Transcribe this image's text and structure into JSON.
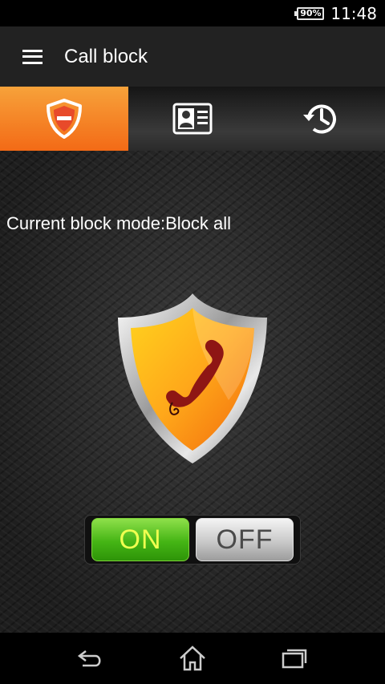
{
  "status_bar": {
    "battery": "90%",
    "time": "11:48"
  },
  "app_bar": {
    "title": "Call block",
    "menu_icon": "hamburger-menu-icon"
  },
  "tabs": [
    {
      "name": "block-shield",
      "icon": "shield-minus-icon",
      "active": true
    },
    {
      "name": "contacts",
      "icon": "contact-card-icon",
      "active": false
    },
    {
      "name": "history",
      "icon": "history-icon",
      "active": false
    }
  ],
  "main": {
    "mode_text": "Current block mode:Block all",
    "shield_icon": "shield-phone-icon",
    "toggle": {
      "on_label": "ON",
      "off_label": "OFF",
      "state": "on"
    }
  },
  "nav": {
    "back_icon": "back-icon",
    "home_icon": "home-icon",
    "recents_icon": "recents-icon"
  },
  "colors": {
    "accent": "#f36a16",
    "on_green": "#45b515",
    "app_bar": "#222222"
  }
}
